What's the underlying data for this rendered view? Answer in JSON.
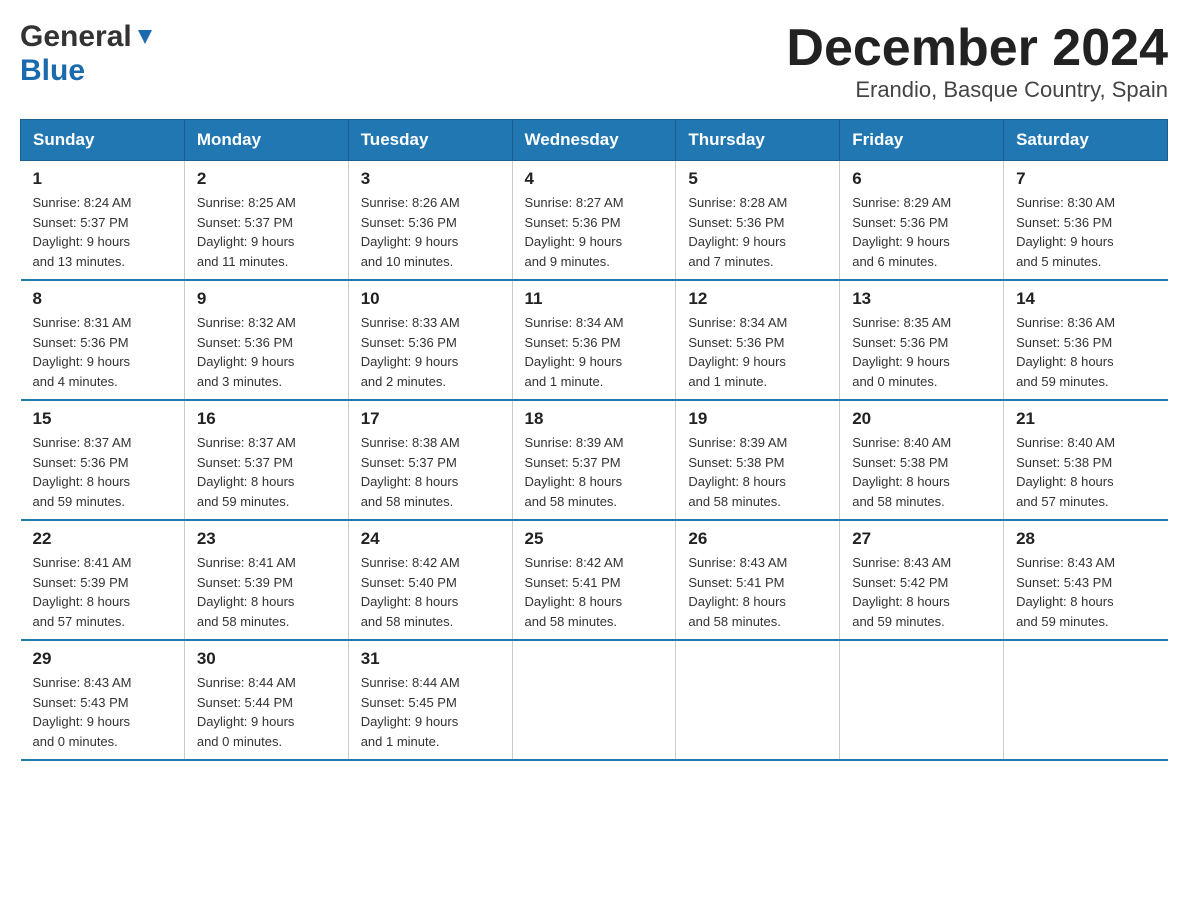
{
  "header": {
    "logo": {
      "general": "General",
      "blue": "Blue"
    },
    "title": "December 2024",
    "location": "Erandio, Basque Country, Spain"
  },
  "calendar": {
    "days_of_week": [
      "Sunday",
      "Monday",
      "Tuesday",
      "Wednesday",
      "Thursday",
      "Friday",
      "Saturday"
    ],
    "weeks": [
      [
        {
          "day": "1",
          "sunrise": "Sunrise: 8:24 AM",
          "sunset": "Sunset: 5:37 PM",
          "daylight": "Daylight: 9 hours",
          "minutes": "and 13 minutes."
        },
        {
          "day": "2",
          "sunrise": "Sunrise: 8:25 AM",
          "sunset": "Sunset: 5:37 PM",
          "daylight": "Daylight: 9 hours",
          "minutes": "and 11 minutes."
        },
        {
          "day": "3",
          "sunrise": "Sunrise: 8:26 AM",
          "sunset": "Sunset: 5:36 PM",
          "daylight": "Daylight: 9 hours",
          "minutes": "and 10 minutes."
        },
        {
          "day": "4",
          "sunrise": "Sunrise: 8:27 AM",
          "sunset": "Sunset: 5:36 PM",
          "daylight": "Daylight: 9 hours",
          "minutes": "and 9 minutes."
        },
        {
          "day": "5",
          "sunrise": "Sunrise: 8:28 AM",
          "sunset": "Sunset: 5:36 PM",
          "daylight": "Daylight: 9 hours",
          "minutes": "and 7 minutes."
        },
        {
          "day": "6",
          "sunrise": "Sunrise: 8:29 AM",
          "sunset": "Sunset: 5:36 PM",
          "daylight": "Daylight: 9 hours",
          "minutes": "and 6 minutes."
        },
        {
          "day": "7",
          "sunrise": "Sunrise: 8:30 AM",
          "sunset": "Sunset: 5:36 PM",
          "daylight": "Daylight: 9 hours",
          "minutes": "and 5 minutes."
        }
      ],
      [
        {
          "day": "8",
          "sunrise": "Sunrise: 8:31 AM",
          "sunset": "Sunset: 5:36 PM",
          "daylight": "Daylight: 9 hours",
          "minutes": "and 4 minutes."
        },
        {
          "day": "9",
          "sunrise": "Sunrise: 8:32 AM",
          "sunset": "Sunset: 5:36 PM",
          "daylight": "Daylight: 9 hours",
          "minutes": "and 3 minutes."
        },
        {
          "day": "10",
          "sunrise": "Sunrise: 8:33 AM",
          "sunset": "Sunset: 5:36 PM",
          "daylight": "Daylight: 9 hours",
          "minutes": "and 2 minutes."
        },
        {
          "day": "11",
          "sunrise": "Sunrise: 8:34 AM",
          "sunset": "Sunset: 5:36 PM",
          "daylight": "Daylight: 9 hours",
          "minutes": "and 1 minute."
        },
        {
          "day": "12",
          "sunrise": "Sunrise: 8:34 AM",
          "sunset": "Sunset: 5:36 PM",
          "daylight": "Daylight: 9 hours",
          "minutes": "and 1 minute."
        },
        {
          "day": "13",
          "sunrise": "Sunrise: 8:35 AM",
          "sunset": "Sunset: 5:36 PM",
          "daylight": "Daylight: 9 hours",
          "minutes": "and 0 minutes."
        },
        {
          "day": "14",
          "sunrise": "Sunrise: 8:36 AM",
          "sunset": "Sunset: 5:36 PM",
          "daylight": "Daylight: 8 hours",
          "minutes": "and 59 minutes."
        }
      ],
      [
        {
          "day": "15",
          "sunrise": "Sunrise: 8:37 AM",
          "sunset": "Sunset: 5:36 PM",
          "daylight": "Daylight: 8 hours",
          "minutes": "and 59 minutes."
        },
        {
          "day": "16",
          "sunrise": "Sunrise: 8:37 AM",
          "sunset": "Sunset: 5:37 PM",
          "daylight": "Daylight: 8 hours",
          "minutes": "and 59 minutes."
        },
        {
          "day": "17",
          "sunrise": "Sunrise: 8:38 AM",
          "sunset": "Sunset: 5:37 PM",
          "daylight": "Daylight: 8 hours",
          "minutes": "and 58 minutes."
        },
        {
          "day": "18",
          "sunrise": "Sunrise: 8:39 AM",
          "sunset": "Sunset: 5:37 PM",
          "daylight": "Daylight: 8 hours",
          "minutes": "and 58 minutes."
        },
        {
          "day": "19",
          "sunrise": "Sunrise: 8:39 AM",
          "sunset": "Sunset: 5:38 PM",
          "daylight": "Daylight: 8 hours",
          "minutes": "and 58 minutes."
        },
        {
          "day": "20",
          "sunrise": "Sunrise: 8:40 AM",
          "sunset": "Sunset: 5:38 PM",
          "daylight": "Daylight: 8 hours",
          "minutes": "and 58 minutes."
        },
        {
          "day": "21",
          "sunrise": "Sunrise: 8:40 AM",
          "sunset": "Sunset: 5:38 PM",
          "daylight": "Daylight: 8 hours",
          "minutes": "and 57 minutes."
        }
      ],
      [
        {
          "day": "22",
          "sunrise": "Sunrise: 8:41 AM",
          "sunset": "Sunset: 5:39 PM",
          "daylight": "Daylight: 8 hours",
          "minutes": "and 57 minutes."
        },
        {
          "day": "23",
          "sunrise": "Sunrise: 8:41 AM",
          "sunset": "Sunset: 5:39 PM",
          "daylight": "Daylight: 8 hours",
          "minutes": "and 58 minutes."
        },
        {
          "day": "24",
          "sunrise": "Sunrise: 8:42 AM",
          "sunset": "Sunset: 5:40 PM",
          "daylight": "Daylight: 8 hours",
          "minutes": "and 58 minutes."
        },
        {
          "day": "25",
          "sunrise": "Sunrise: 8:42 AM",
          "sunset": "Sunset: 5:41 PM",
          "daylight": "Daylight: 8 hours",
          "minutes": "and 58 minutes."
        },
        {
          "day": "26",
          "sunrise": "Sunrise: 8:43 AM",
          "sunset": "Sunset: 5:41 PM",
          "daylight": "Daylight: 8 hours",
          "minutes": "and 58 minutes."
        },
        {
          "day": "27",
          "sunrise": "Sunrise: 8:43 AM",
          "sunset": "Sunset: 5:42 PM",
          "daylight": "Daylight: 8 hours",
          "minutes": "and 59 minutes."
        },
        {
          "day": "28",
          "sunrise": "Sunrise: 8:43 AM",
          "sunset": "Sunset: 5:43 PM",
          "daylight": "Daylight: 8 hours",
          "minutes": "and 59 minutes."
        }
      ],
      [
        {
          "day": "29",
          "sunrise": "Sunrise: 8:43 AM",
          "sunset": "Sunset: 5:43 PM",
          "daylight": "Daylight: 9 hours",
          "minutes": "and 0 minutes."
        },
        {
          "day": "30",
          "sunrise": "Sunrise: 8:44 AM",
          "sunset": "Sunset: 5:44 PM",
          "daylight": "Daylight: 9 hours",
          "minutes": "and 0 minutes."
        },
        {
          "day": "31",
          "sunrise": "Sunrise: 8:44 AM",
          "sunset": "Sunset: 5:45 PM",
          "daylight": "Daylight: 9 hours",
          "minutes": "and 1 minute."
        },
        {
          "day": "",
          "sunrise": "",
          "sunset": "",
          "daylight": "",
          "minutes": ""
        },
        {
          "day": "",
          "sunrise": "",
          "sunset": "",
          "daylight": "",
          "minutes": ""
        },
        {
          "day": "",
          "sunrise": "",
          "sunset": "",
          "daylight": "",
          "minutes": ""
        },
        {
          "day": "",
          "sunrise": "",
          "sunset": "",
          "daylight": "",
          "minutes": ""
        }
      ]
    ]
  }
}
